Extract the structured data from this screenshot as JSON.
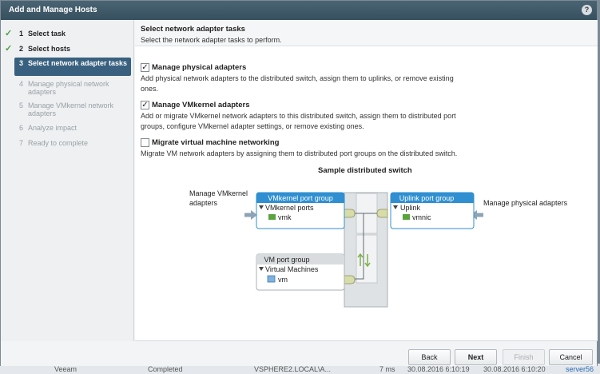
{
  "dialog": {
    "title": "Add and Manage Hosts",
    "help_label": "?"
  },
  "steps": [
    {
      "num": "1",
      "label": "Select task",
      "state": "done"
    },
    {
      "num": "2",
      "label": "Select hosts",
      "state": "done"
    },
    {
      "num": "3",
      "label": "Select network adapter tasks",
      "state": "active"
    },
    {
      "num": "4",
      "label": "Manage physical network adapters",
      "state": "pending"
    },
    {
      "num": "5",
      "label": "Manage VMkernel network adapters",
      "state": "pending"
    },
    {
      "num": "6",
      "label": "Analyze impact",
      "state": "pending"
    },
    {
      "num": "7",
      "label": "Ready to complete",
      "state": "pending"
    }
  ],
  "header": {
    "title": "Select network adapter tasks",
    "subtitle": "Select the network adapter tasks to perform."
  },
  "options": [
    {
      "label": "Manage physical adapters",
      "checked": true,
      "description": "Add physical network adapters to the distributed switch, assign them to uplinks, or remove existing ones."
    },
    {
      "label": "Manage VMkernel adapters",
      "checked": true,
      "description": "Add or migrate VMkernel network adapters to this distributed switch, assign them to distributed port groups, configure VMkernel adapter settings, or remove existing ones."
    },
    {
      "label": "Migrate virtual machine networking",
      "checked": false,
      "description": "Migrate VM network adapters by assigning them to distributed port groups on the distributed switch."
    }
  ],
  "diagram": {
    "title": "Sample distributed switch",
    "left_label": "Manage VMkernel adapters",
    "right_label": "Manage physical adapters",
    "vmk_group": {
      "title": "VMkernel port group",
      "folder": "VMkernel ports",
      "item": "vmk"
    },
    "vm_group": {
      "title": "VM port group",
      "folder": "Virtual Machines",
      "item": "vm"
    },
    "uplink_group": {
      "title": "Uplink port group",
      "folder": "Uplink",
      "item": "vmnic"
    }
  },
  "footer": {
    "back": "Back",
    "next": "Next",
    "finish": "Finish",
    "cancel": "Cancel"
  },
  "background": {
    "col1": "Veeam",
    "col2": "Completed",
    "col3": "VSPHERE2.LOCAL\\A...",
    "col4": "7 ms",
    "col5": "30.08.2016 6:10:19",
    "col6": "30.08.2016 6:10:20",
    "col7": "server56"
  },
  "colors": {
    "accent": "#39607f",
    "group_header": "#2f8fd0",
    "check": "#4aa241"
  }
}
